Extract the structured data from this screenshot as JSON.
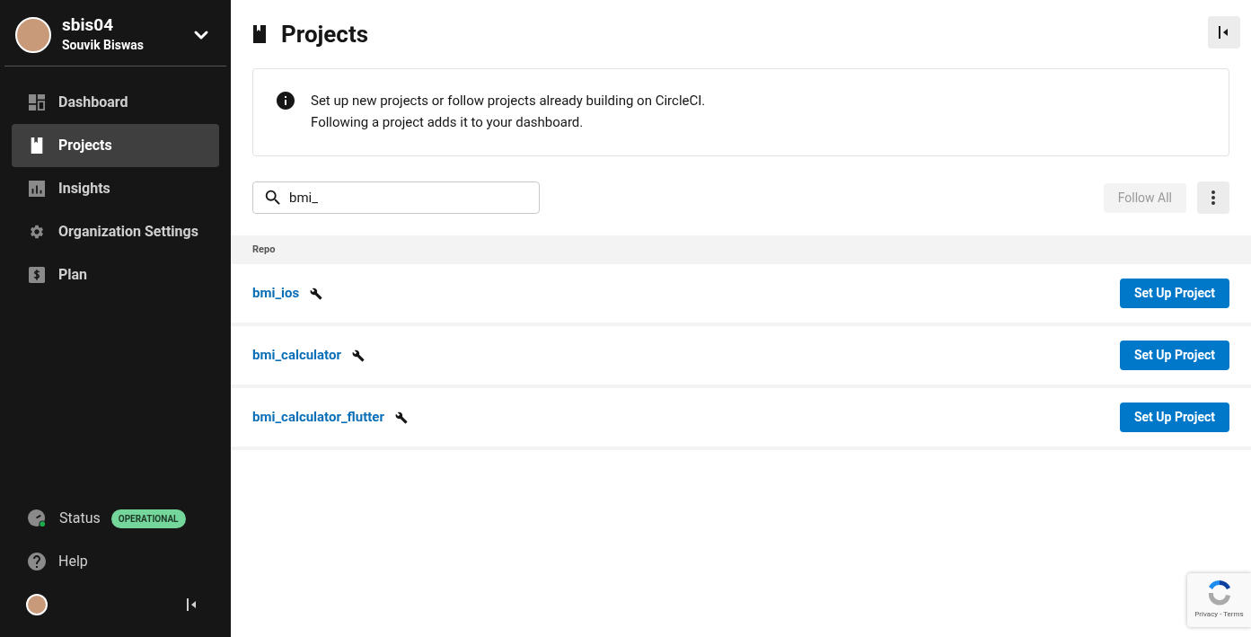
{
  "account": {
    "username": "sbis04",
    "full_name": "Souvik Biswas"
  },
  "nav": [
    {
      "label": "Dashboard",
      "selected": false
    },
    {
      "label": "Projects",
      "selected": true
    },
    {
      "label": "Insights",
      "selected": false
    },
    {
      "label": "Organization Settings",
      "selected": false
    },
    {
      "label": "Plan",
      "selected": false
    }
  ],
  "status": {
    "label": "Status",
    "badge": "OPERATIONAL"
  },
  "help": {
    "label": "Help"
  },
  "page": {
    "title": "Projects",
    "info_lines": [
      "Set up new projects or follow projects already building on CircleCI.",
      "Following a project adds it to your dashboard."
    ]
  },
  "search": {
    "value": "bmi_"
  },
  "follow_all": {
    "label": "Follow All",
    "disabled": true
  },
  "table": {
    "column": "Repo",
    "rows": [
      {
        "name": "bmi_ios",
        "action": "Set Up Project"
      },
      {
        "name": "bmi_calculator",
        "action": "Set Up Project"
      },
      {
        "name": "bmi_calculator_flutter",
        "action": "Set Up Project"
      }
    ]
  },
  "recaptcha": {
    "links": "Privacy - Terms"
  }
}
